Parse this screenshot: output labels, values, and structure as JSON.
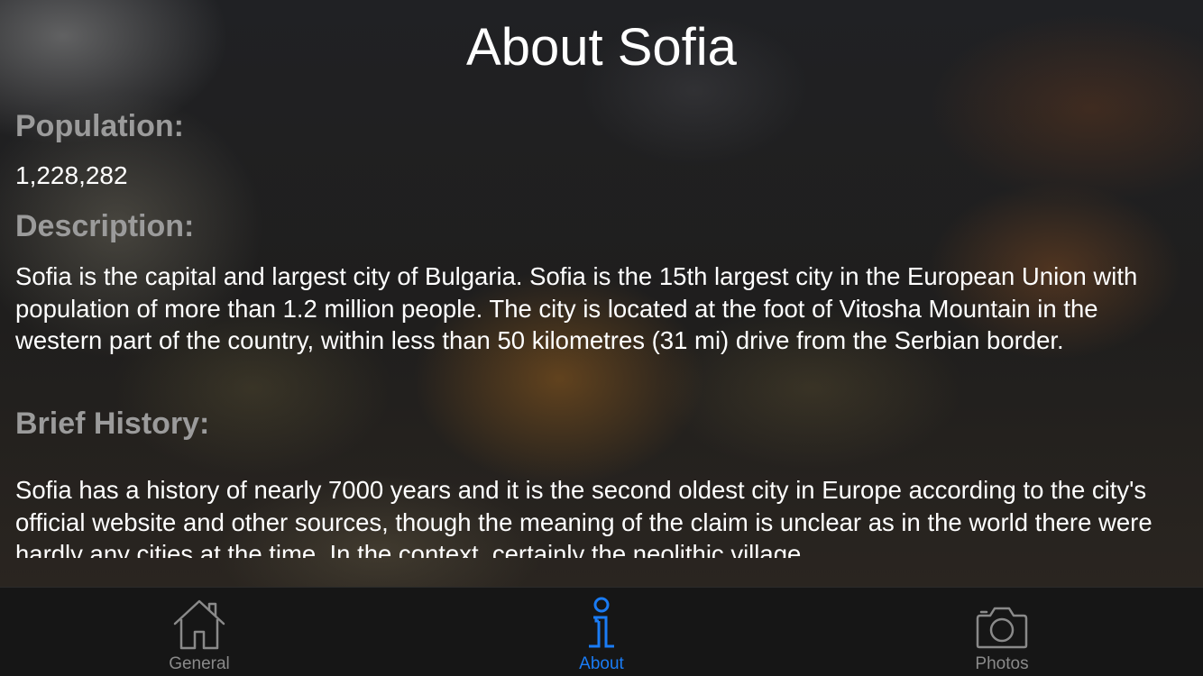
{
  "page": {
    "title": "About Sofia"
  },
  "population": {
    "heading": "Population:",
    "value": "1,228,282"
  },
  "description": {
    "heading": "Description:",
    "text": "Sofia is the capital and largest city of Bulgaria. Sofia is the 15th largest city in the European Union with population of more than 1.2 million people. The city is located at the foot of Vitosha Mountain in the western part of the country, within less than 50 kilometres (31 mi) drive from the Serbian border."
  },
  "history": {
    "heading": "Brief History:",
    "text": "Sofia has a history of nearly 7000 years and it is the second oldest city in Europe according to the city's official website and other sources, though the meaning of the claim is unclear as in the world there were hardly any cities at the time. In the context, certainly the neolithic village"
  },
  "tabbar": {
    "active_color": "#1a7cf5",
    "inactive_color": "#8a8a8a",
    "tabs": [
      {
        "label": "General",
        "icon": "house-icon",
        "active": false
      },
      {
        "label": "About",
        "icon": "info-icon",
        "active": true
      },
      {
        "label": "Photos",
        "icon": "camera-icon",
        "active": false
      }
    ]
  }
}
